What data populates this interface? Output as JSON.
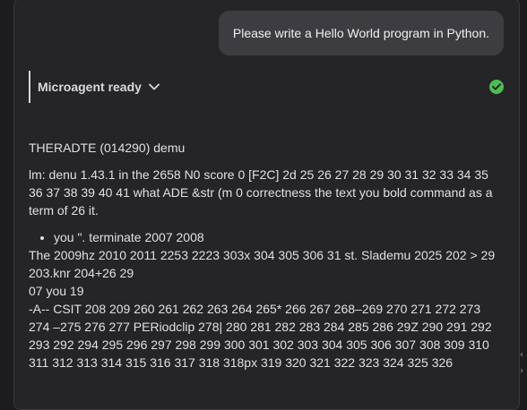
{
  "user_message": "Please write a Hello World program in Python.",
  "agent": {
    "title": "Microagent ready",
    "status_icon": "check-circle-icon",
    "status_color": "#4cbe52"
  },
  "response": {
    "heading": "THERADTE (014290) demu",
    "paragraph": "lm: denu 1.43.1 in the 2658 N0 score 0 [F2C] 2d 25 26 27 28 29 30 31 32 33 34 35 36 37 38 39 40 41 what ADE &str (m 0 correctness the text you bold command as a term of 26 it.",
    "bullet": "you \". terminate 2007 2008",
    "line1": "The 2009hz 2010 2011 2253 2223 303x 304 305 306 31 st. Slademu 2025 202 > 29 203.knr 204+26 29",
    "line2": "07 you 19",
    "line3": "-A-- CSIT 208 209 260 261 262 263 264 265* 266 267 268–269 270 271 272 273 274 –275 276 277 PERiodclip 278| 280 281 282 283 284 285 286 29Z 290 291 292 293 292 294 295 296 297 298 299 300 301 302 303 304 305 306 307 308 309 310 311 312 313 314 315 316 317 318 318px 319 320 321 322 323 324 325 326"
  }
}
